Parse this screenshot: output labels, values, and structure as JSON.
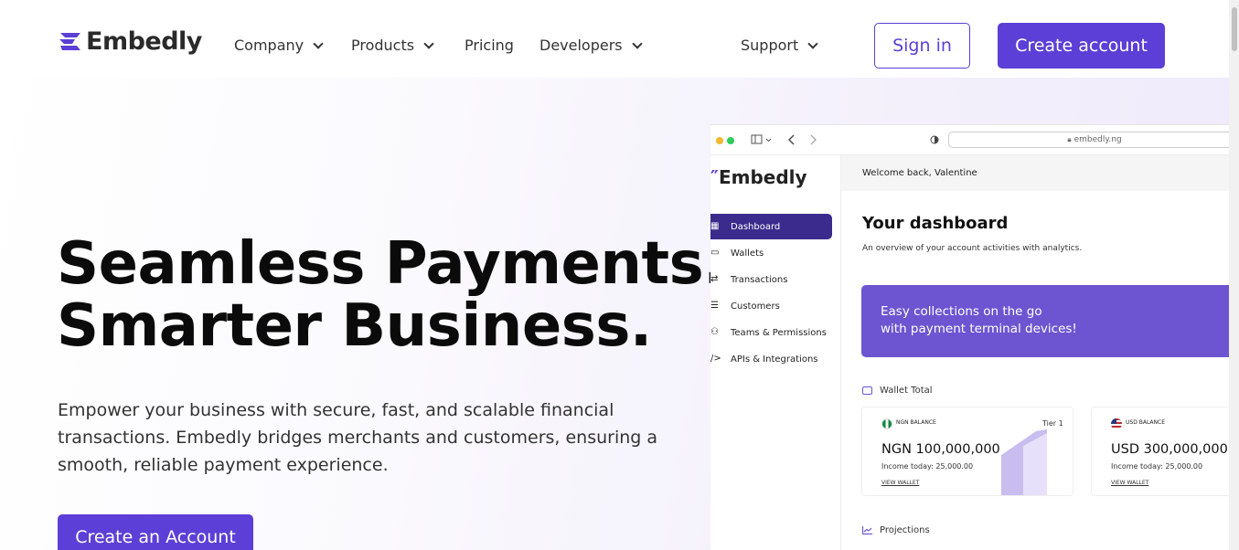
{
  "header": {
    "logo_text": "Embedly",
    "nav": [
      {
        "label": "Company",
        "dropdown": true
      },
      {
        "label": "Products",
        "dropdown": true
      },
      {
        "label": "Pricing",
        "dropdown": false
      },
      {
        "label": "Developers",
        "dropdown": true
      },
      {
        "label": "Support",
        "dropdown": true
      }
    ],
    "signin_label": "Sign in",
    "create_label": "Create account"
  },
  "hero": {
    "headline_line1": "Seamless Payments.",
    "headline_line2": "Smarter Business.",
    "subtext": "Empower your business with secure, fast, and scalable financial transactions. Embedly bridges merchants and customers, ensuring a smooth, reliable payment experience.",
    "cta_label": "Create an Account"
  },
  "mock": {
    "url": "embedly.ng",
    "logo_text": "Embedly",
    "menu": [
      "Dashboard",
      "Wallets",
      "Transactions",
      "Customers",
      "Teams & Permissions",
      "APIs & Integrations"
    ],
    "welcome": "Welcome back,  Valentine",
    "title": "Your dashboard",
    "subtitle": "An overview of your account activities with analytics.",
    "banner_line1": "Easy collections on the go",
    "banner_line2": "with payment terminal devices!",
    "wallet_total_label": "Wallet Total",
    "projections_label": "Projections",
    "cards": [
      {
        "balance_label": "NGN BALANCE",
        "amount": "NGN 100,000,000",
        "income": "Income today:  25,000.00",
        "view": "VIEW WALLET",
        "tier": "Tier 1"
      },
      {
        "balance_label": "USD BALANCE",
        "amount": "USD 300,000,000",
        "income": "Income today:  25,000.00",
        "view": "VIEW WALLET"
      }
    ]
  },
  "colors": {
    "brand": "#5b3fd6",
    "sidebar_active": "#3b2b8c",
    "banner": "#6d55d1"
  }
}
